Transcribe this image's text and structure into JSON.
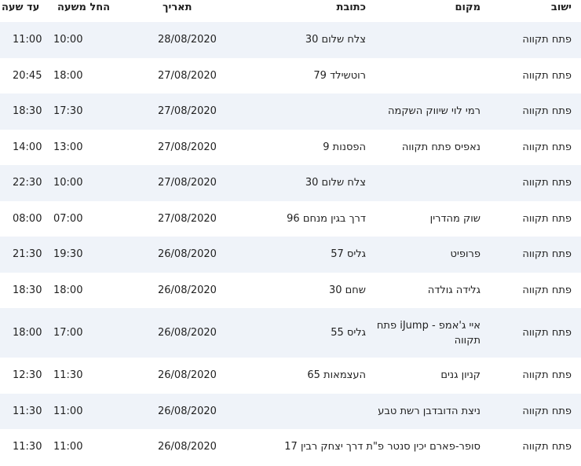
{
  "headers": {
    "city": "ישוב",
    "place": "מקום",
    "address": "כתובת",
    "date": "תאריך",
    "from": "החל משעה",
    "to": "עד שעה"
  },
  "rows": [
    {
      "city": "פתח תקווה",
      "place": "",
      "address": "צלח שלום 30",
      "date": "28/08/2020",
      "from": "10:00",
      "to": "11:00"
    },
    {
      "city": "פתח תקווה",
      "place": "",
      "address": "רוטשילד 79",
      "date": "27/08/2020",
      "from": "18:00",
      "to": "20:45"
    },
    {
      "city": "פתח תקווה",
      "place": "רמי לוי שיווק השקמה",
      "address": "",
      "date": "27/08/2020",
      "from": "17:30",
      "to": "18:30"
    },
    {
      "city": "פתח תקווה",
      "place": "נאפיס פתח תקווה",
      "address": "הפסנות 9",
      "date": "27/08/2020",
      "from": "13:00",
      "to": "14:00"
    },
    {
      "city": "פתח תקווה",
      "place": "",
      "address": "צלח שלום 30",
      "date": "27/08/2020",
      "from": "10:00",
      "to": "22:30"
    },
    {
      "city": "פתח תקווה",
      "place": "שוק מהדרין",
      "address": "דרך בגין מנחם 96",
      "date": "27/08/2020",
      "from": "07:00",
      "to": "08:00"
    },
    {
      "city": "פתח תקווה",
      "place": "פרופיט",
      "address": "גליס 57",
      "date": "26/08/2020",
      "from": "19:30",
      "to": "21:30"
    },
    {
      "city": "פתח תקווה",
      "place": "גלידה גולדה",
      "address": "שחם 30",
      "date": "26/08/2020",
      "from": "18:00",
      "to": "18:30"
    },
    {
      "city": "פתח תקווה",
      "place": "איי ג'אמפ - iJump פתח תקווה",
      "address": "גליס 55",
      "date": "26/08/2020",
      "from": "17:00",
      "to": "18:00"
    },
    {
      "city": "פתח תקווה",
      "place": "קניון גנים",
      "address": "העצמאות 65",
      "date": "26/08/2020",
      "from": "11:30",
      "to": "12:30"
    },
    {
      "city": "פתח תקווה",
      "place": "ניצת הדובדבן רשת טבע",
      "address": "",
      "date": "26/08/2020",
      "from": "11:00",
      "to": "11:30"
    },
    {
      "city": "פתח תקווה",
      "place": "סופר-פארם יכין סנטר פ\"ת דרך יצחק רבין 17",
      "address": "",
      "date": "26/08/2020",
      "from": "11:00",
      "to": "11:30"
    }
  ],
  "colors": {
    "alt_row": "#eff3f9",
    "text": "#222222"
  }
}
